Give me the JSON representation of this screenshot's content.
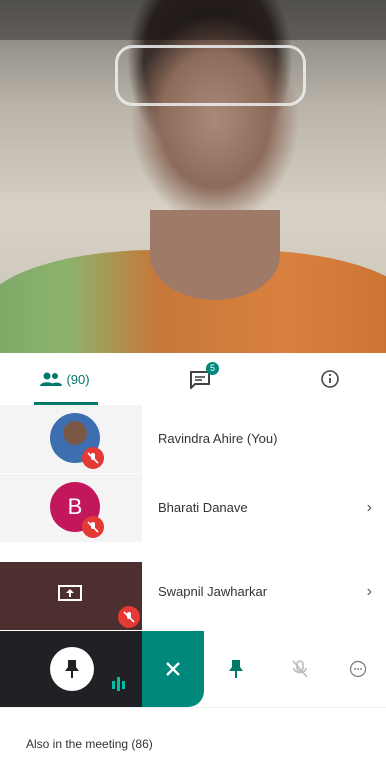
{
  "tabs": {
    "people_count": "(90)",
    "chat_badge": "5"
  },
  "participants": [
    {
      "name": "Ravindra Ahire (You)"
    },
    {
      "name": "Bharati Danave",
      "avatar_letter": "B"
    },
    {
      "name": "Swapnil Jawharkar"
    }
  ],
  "footer": {
    "also_label": "Also in the meeting (86)"
  },
  "colors": {
    "accent": "#00796b",
    "mute": "#e53935",
    "avatar_b": "#c2185b"
  }
}
